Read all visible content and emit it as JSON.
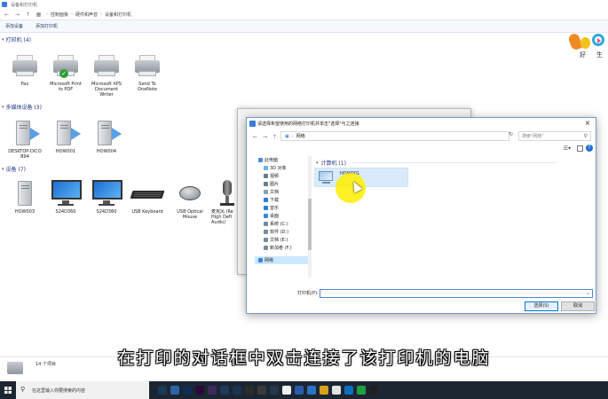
{
  "window": {
    "title": "设备和打印机"
  },
  "address": {
    "crumbs": [
      "控制面板",
      "硬件和声音",
      "设备和打印机"
    ]
  },
  "commands": {
    "add_device": "添加设备",
    "add_printer": "添加打印机"
  },
  "sections": {
    "printers": "打印机 (4)",
    "multimedia": "多媒体设备 (3)",
    "devices": "设备 (7)"
  },
  "printers": [
    "Fax",
    "Microsoft Print\nto PDF",
    "Microsoft XPS\nDocument\nWriter",
    "Send To\nOneNote"
  ],
  "multimedia": [
    "DESKTOP-DICO\nB94",
    "HOW001",
    "HOW004"
  ],
  "devices": [
    "HOW003",
    "S24D360",
    "S24D360",
    "USB Keyboard",
    "USB Optical\nMouse",
    "麦克风 (Re\nHigh Defi\nAudio)"
  ],
  "status": {
    "count": "14 个项目"
  },
  "logo": {
    "chars": [
      "好",
      "生"
    ]
  },
  "dialog": {
    "title": "请选择希望使用的网络打印机并单击\"选择\"与之连接",
    "location": "网络",
    "search_placeholder": "搜索\"网络\"",
    "toolbar_organize": "组织 ▾",
    "nav": [
      {
        "label": "此电脑",
        "level": 0,
        "color": "#4a8fd8"
      },
      {
        "label": "3D 对象",
        "level": 1,
        "color": "#6bb3f0"
      },
      {
        "label": "视频",
        "level": 1,
        "color": "#6b7c8c"
      },
      {
        "label": "图片",
        "level": 1,
        "color": "#6b7c8c"
      },
      {
        "label": "文档",
        "level": 1,
        "color": "#8fa0b0"
      },
      {
        "label": "下载",
        "level": 1,
        "color": "#2a7fd4"
      },
      {
        "label": "音乐",
        "level": 1,
        "color": "#2a7fd4"
      },
      {
        "label": "桌面",
        "level": 1,
        "color": "#3b86d8"
      },
      {
        "label": "系统 (C:)",
        "level": 1,
        "color": "#7a8a99"
      },
      {
        "label": "软件 (D:)",
        "level": 1,
        "color": "#7a8a99"
      },
      {
        "label": "文档 (E:)",
        "level": 1,
        "color": "#7a8a99"
      },
      {
        "label": "新加卷 (F:)",
        "level": 1,
        "color": "#7a8a99"
      },
      {
        "label": "网络",
        "level": 0,
        "color": "#3b86d8"
      }
    ],
    "group": "计算机 (1)",
    "computer": "HOW001",
    "printer_label": "打印机(P):",
    "printer_value": "",
    "select": "选择(S)",
    "cancel": "取消"
  },
  "subtitle": "在打印的对话框中双击连接了该打印机的电脑",
  "taskbar": {
    "search_placeholder": "在这里输入你要搜索的内容",
    "apps": [
      "#1b3a55",
      "#2d64a8",
      "#0f2d55",
      "#2a0a3a",
      "#3d2a5a",
      "#1e3a5a",
      "#1a3350",
      "#2c2c2c",
      "#3a3a3a",
      "#27364a",
      "#f0f0f0",
      "#2a5caa",
      "#2a73c8",
      "#d9a21b",
      "#e3e3e3",
      "#0c70c0",
      "#1fa040",
      "#202020"
    ]
  }
}
